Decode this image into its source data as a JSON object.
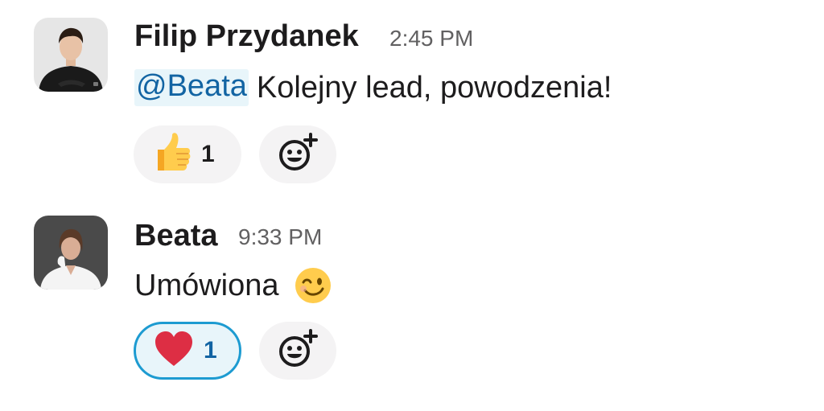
{
  "messages": [
    {
      "author": "Filip Przydanek",
      "time": "2:45 PM",
      "mention": "@Beata",
      "text": "Kolejny lead, powodzenia!",
      "reaction": {
        "emoji": "thumbs-up",
        "count": "1"
      },
      "add_reaction_icon": "add-emoji-icon"
    },
    {
      "author": "Beata",
      "time": "9:33 PM",
      "text": "Umówiona",
      "inline_emoji": "winking-face",
      "reaction": {
        "emoji": "red-heart",
        "count": "1",
        "selected": true
      },
      "add_reaction_icon": "add-emoji-icon"
    }
  ],
  "colors": {
    "mention_bg": "#e8f5fa",
    "mention_text": "#1264a3",
    "selected_reaction_border": "#1d9bd1"
  }
}
